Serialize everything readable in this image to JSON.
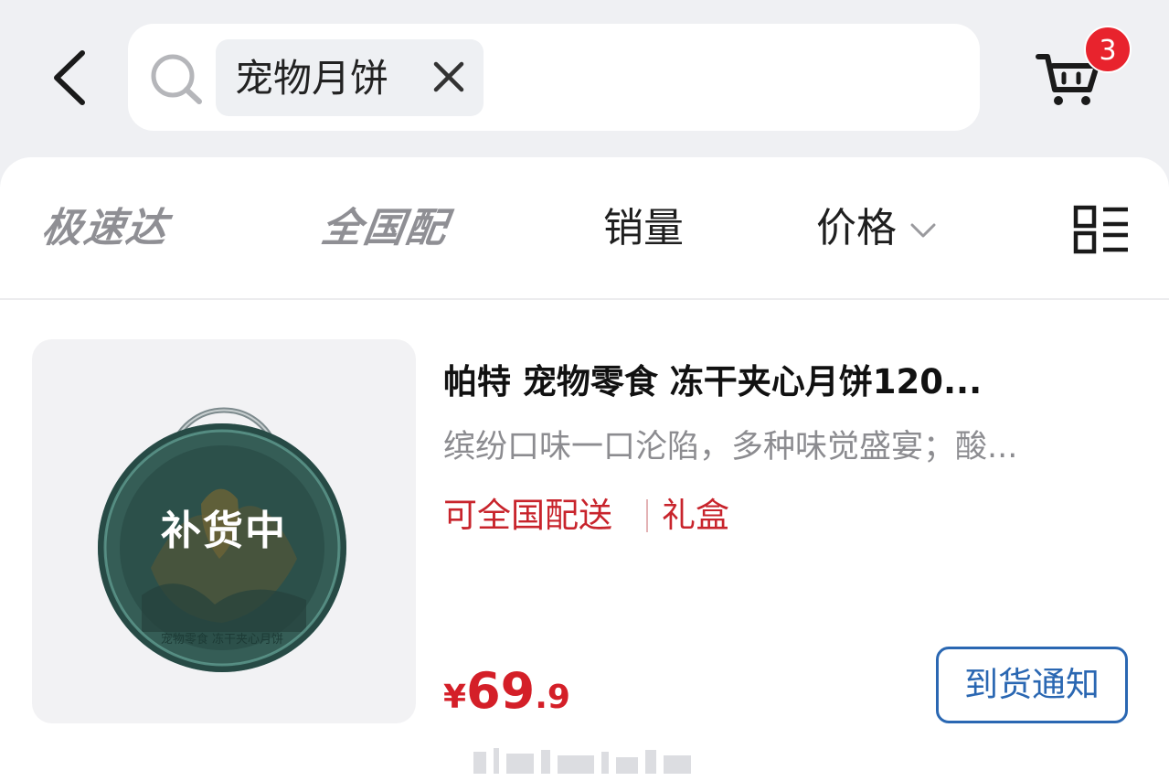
{
  "header": {
    "search_chip": "宠物月饼",
    "cart_count": "3",
    "icons": {
      "back": "back-arrow-icon",
      "search": "search-icon",
      "clear": "close-icon",
      "cart": "cart-icon"
    }
  },
  "sort_bar": {
    "tabs": [
      {
        "label": "极速达"
      },
      {
        "label": "全国配"
      },
      {
        "label": "销量"
      },
      {
        "label": "价格"
      }
    ],
    "layout_toggle_icon": "list-grid-toggle-icon"
  },
  "product": {
    "status_overlay": "补货中",
    "title": "帕特 宠物零食 冻干夹心月饼120...",
    "subtitle": "缤纷口味一口沦陷，多种味觉盛宴；酸...",
    "tags": [
      "可全国配送",
      "礼盒"
    ],
    "price": {
      "currency": "¥",
      "integer": "69",
      "decimal": ".9"
    },
    "notify_button": "到货通知",
    "image_label": "宠物零食 冻干夹心月饼",
    "colors": {
      "price": "#d41f28",
      "tag": "#c8242c",
      "button": "#2a67b2"
    }
  }
}
